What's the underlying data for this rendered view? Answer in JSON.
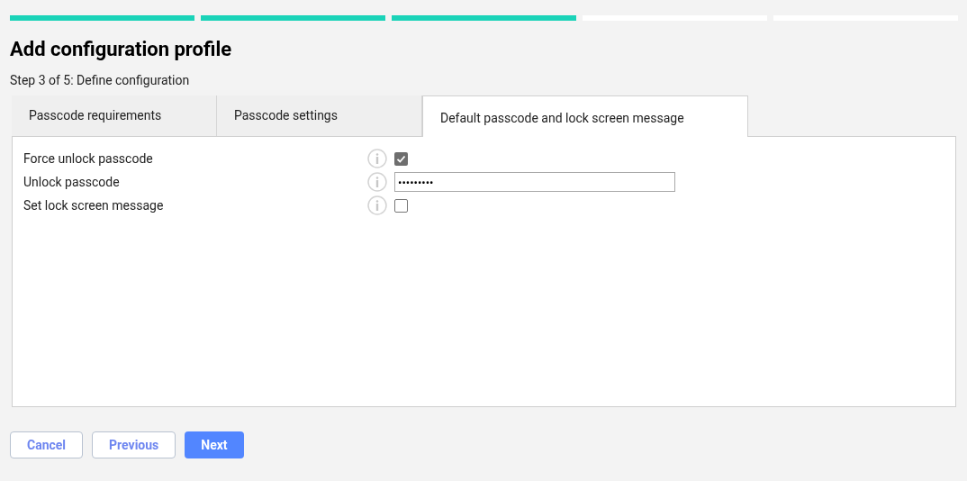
{
  "progress": [
    {
      "done": true
    },
    {
      "done": true
    },
    {
      "done": true
    },
    {
      "done": false
    },
    {
      "done": false
    }
  ],
  "title": "Add configuration profile",
  "step": "Step 3 of 5: Define configuration",
  "tabs": [
    {
      "label": "Passcode requirements",
      "selected": false
    },
    {
      "label": "Passcode settings",
      "selected": false
    },
    {
      "label": "Default passcode and lock screen message",
      "selected": true
    }
  ],
  "fields": [
    {
      "kind": "checkbox",
      "label": "Force unlock passcode",
      "checked": true
    },
    {
      "kind": "password",
      "label": "Unlock passcode",
      "value": "•••••••••"
    },
    {
      "kind": "checkbox",
      "label": "Set lock screen message",
      "checked": false
    }
  ],
  "buttons": [
    {
      "label": "Cancel",
      "kind": "secondary"
    },
    {
      "label": "Previous",
      "kind": "secondary"
    },
    {
      "label": "Next",
      "kind": "primary"
    }
  ]
}
